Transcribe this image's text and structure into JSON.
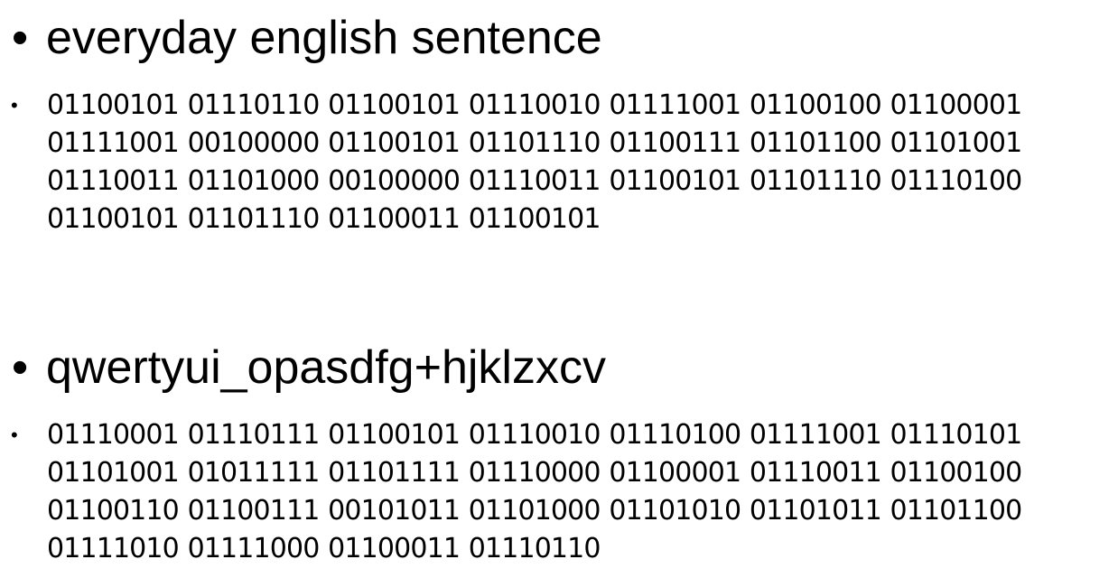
{
  "bullets": [
    {
      "heading": "everyday english sentence",
      "binary": "01100101 01110110 01100101 01110010 01111001 01100100 01100001 01111001 00100000 01100101 01101110 01100111 01101100 01101001 01110011 01101000 00100000 01110011 01100101 01101110 01110100 01100101 01101110 01100011 01100101"
    },
    {
      "heading": "qwertyui_opasdfg+hjklzxcv",
      "binary": "01110001 01110111 01100101 01110010 01110100 01111001 01110101 01101001 01011111 01101111 01110000 01100001 01110011 01100100 01100110 01100111 00101011 01101000 01101010 01101011 01101100 01111010 01111000 01100011 01110110"
    }
  ],
  "bullet_glyph": "•"
}
